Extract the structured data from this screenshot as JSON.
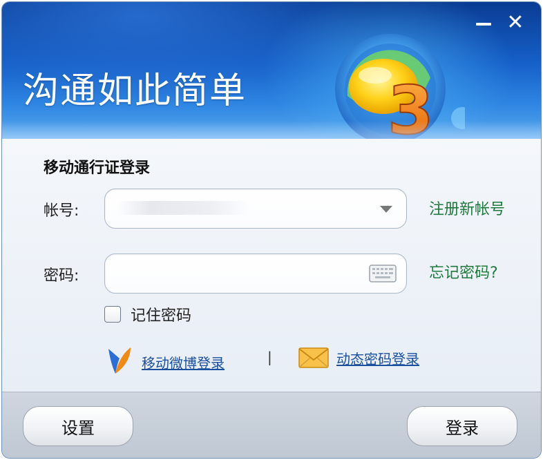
{
  "window": {
    "minimize_glyph": "—",
    "close_glyph": "✕"
  },
  "banner": {
    "slogan": "沟通如此简单",
    "logo_icon": "feixin-3-logo"
  },
  "form": {
    "title": "移动通行证登录",
    "account_label": "帐号:",
    "account_value": "",
    "password_label": "密码:",
    "password_value": "",
    "register_link": "注册新帐号",
    "forgot_link": "忘记密码?",
    "remember_label": "记住密码",
    "remember_checked": false,
    "weibo_login": "移动微博登录",
    "separator": "|",
    "dynamic_login": "动态密码登录"
  },
  "footer": {
    "settings_label": "设置",
    "login_label": "登录"
  },
  "colors": {
    "banner_dark": "#0a3c93",
    "link_green": "#1d7a3c",
    "link_blue": "#1a4f9e"
  }
}
